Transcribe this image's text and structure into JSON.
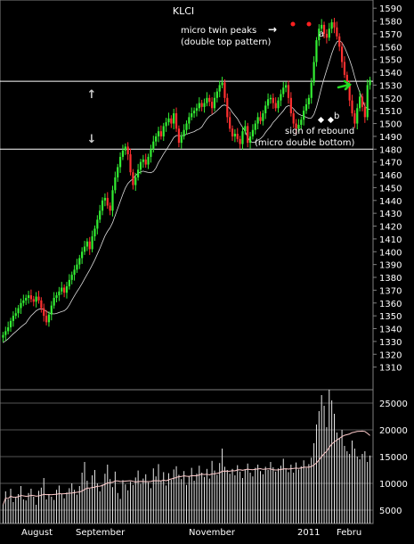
{
  "chart_data": {
    "type": "candlestick",
    "title": "KLCI",
    "price_axis": {
      "ylim": [
        1300,
        1595
      ],
      "ticks": [
        1310,
        1320,
        1330,
        1340,
        1350,
        1360,
        1370,
        1380,
        1390,
        1400,
        1410,
        1420,
        1430,
        1440,
        1450,
        1460,
        1470,
        1480,
        1490,
        1500,
        1510,
        1520,
        1530,
        1540,
        1550,
        1560,
        1570,
        1580,
        1590
      ]
    },
    "volume_axis": {
      "ylim": [
        2500,
        27500
      ],
      "ticks": [
        5000,
        10000,
        15000,
        20000,
        25000
      ],
      "tick_labels": [
        "5000",
        "10000",
        "15000",
        "20000",
        "25000"
      ]
    },
    "month_labels": [
      "August",
      "September",
      "November",
      "2011",
      "Febru"
    ],
    "support_line": 1480,
    "resistance_line": 1533,
    "annotations": {
      "twin_peaks_line1": "micro twin peaks",
      "twin_peaks_line2": "(double top pattern)",
      "label_a": "a",
      "label_b": "b",
      "rebound_line1": "sign of rebound",
      "rebound_line2": "(micro double bottom)",
      "arrow_right": "→",
      "arrow_up": "↑",
      "arrow_down": "↓"
    },
    "closes": [
      1335,
      1338,
      1341,
      1346,
      1350,
      1352,
      1356,
      1360,
      1362,
      1364,
      1366,
      1363,
      1361,
      1365,
      1362,
      1356,
      1350,
      1345,
      1351,
      1358,
      1364,
      1366,
      1369,
      1372,
      1368,
      1373,
      1378,
      1382,
      1386,
      1390,
      1395,
      1400,
      1404,
      1408,
      1402,
      1412,
      1418,
      1425,
      1432,
      1440,
      1442,
      1436,
      1432,
      1448,
      1458,
      1466,
      1474,
      1479,
      1482,
      1476,
      1462,
      1452,
      1458,
      1464,
      1470,
      1472,
      1468,
      1474,
      1480,
      1486,
      1490,
      1494,
      1490,
      1498,
      1501,
      1504,
      1500,
      1508,
      1496,
      1485,
      1490,
      1495,
      1500,
      1505,
      1508,
      1510,
      1512,
      1516,
      1513,
      1516,
      1520,
      1517,
      1512,
      1520,
      1525,
      1530,
      1532,
      1520,
      1505,
      1496,
      1490,
      1492,
      1488,
      1484,
      1494,
      1498,
      1485,
      1490,
      1495,
      1500,
      1505,
      1502,
      1508,
      1514,
      1519,
      1520,
      1516,
      1512,
      1518,
      1523,
      1528,
      1530,
      1520,
      1508,
      1500,
      1496,
      1499,
      1503,
      1510,
      1515,
      1520,
      1532,
      1548,
      1565,
      1574,
      1577,
      1570,
      1567,
      1574,
      1579,
      1575,
      1568,
      1560,
      1548,
      1538,
      1530,
      1518,
      1508,
      1500,
      1512,
      1521,
      1513,
      1505,
      1530,
      1534
    ],
    "volumes": [
      6000,
      8500,
      7000,
      9000,
      6500,
      7500,
      8000,
      9500,
      7000,
      6800,
      8200,
      9000,
      7500,
      6000,
      8600,
      9200,
      11000,
      7000,
      8000,
      7500,
      6900,
      8800,
      9600,
      8000,
      7200,
      8300,
      9100,
      10000,
      8800,
      7900,
      9500,
      12000,
      14000,
      10500,
      9000,
      11500,
      12500,
      10000,
      8500,
      9800,
      11800,
      13500,
      10800,
      9300,
      12200,
      8200,
      7100,
      10600,
      9800,
      8700,
      10300,
      9700,
      11100,
      12400,
      9900,
      10900,
      11700,
      10200,
      9100,
      12800,
      11300,
      13600,
      10400,
      12100,
      9600,
      11900,
      10700,
      12600,
      13200,
      11600,
      10800,
      12300,
      9700,
      11400,
      12900,
      10500,
      11800,
      13300,
      12000,
      11200,
      12700,
      10900,
      14200,
      12400,
      11600,
      13800,
      16500,
      13100,
      12500,
      11800,
      12700,
      11500,
      13400,
      12200,
      11000,
      12600,
      13700,
      12000,
      11300,
      12900,
      13500,
      12300,
      11700,
      13100,
      12500,
      14000,
      13000,
      12200,
      12800,
      13300,
      14600,
      12700,
      12100,
      13500,
      12000,
      13900,
      12600,
      13200,
      14300,
      12900,
      13600,
      14800,
      17500,
      21000,
      23500,
      26500,
      24500,
      20500,
      27500,
      25500,
      23000,
      19500,
      18500,
      20000,
      17000,
      16000,
      15500,
      18000,
      16500,
      15000,
      14500,
      15500,
      16000,
      14000,
      15200
    ]
  }
}
